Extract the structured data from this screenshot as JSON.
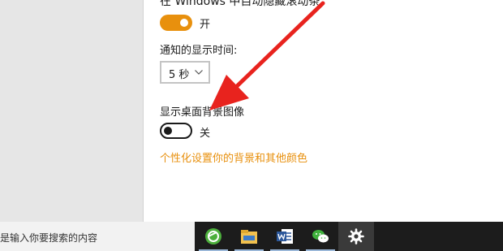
{
  "settings": {
    "scroll_setting_label": "在 Windows 中自动隐藏滚动条",
    "scroll_toggle": {
      "state": "on",
      "text": "开"
    },
    "notification_time_label": "通知的显示时间:",
    "notification_time_value": "5 秒",
    "background_label": "显示桌面背景图像",
    "background_toggle": {
      "state": "off",
      "text": "关"
    },
    "personalize_link": "个性化设置你的背景和其他颜色"
  },
  "taskbar": {
    "search_placeholder": "是输入你要搜索的内容",
    "apps": [
      {
        "name": "360-browser-icon",
        "active": false
      },
      {
        "name": "file-explorer-icon",
        "active": false
      },
      {
        "name": "word-icon",
        "active": false
      },
      {
        "name": "wechat-icon",
        "active": false
      },
      {
        "name": "settings-gear-icon",
        "active": true
      }
    ]
  },
  "colors": {
    "accent": "#e8900d",
    "arrow": "#e8231e",
    "taskbar": "#1c1c1c",
    "left_pane": "#e6e6e6"
  }
}
